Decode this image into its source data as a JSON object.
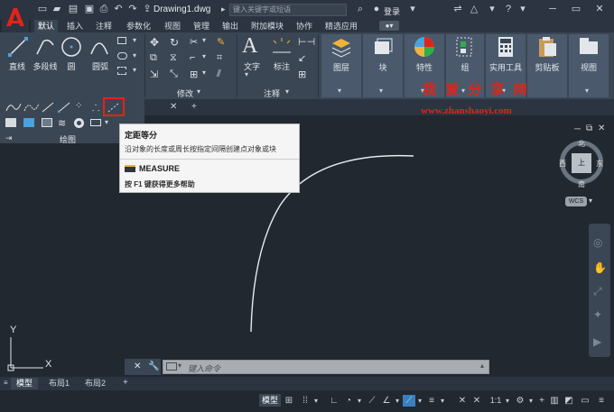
{
  "titlebar": {
    "document_title": "Drawing1.dwg",
    "search_placeholder": "键入关键字或短语",
    "login_label": "登录"
  },
  "menu_tabs": [
    "默认",
    "插入",
    "注释",
    "参数化",
    "视图",
    "管理",
    "输出",
    "附加模块",
    "协作",
    "精选应用"
  ],
  "ribbon": {
    "draw": {
      "tools": [
        "直线",
        "多段线",
        "圆",
        "圆弧"
      ],
      "panel_title": "绘图"
    },
    "modify": {
      "panel_title": "修改"
    },
    "annotation": {
      "tools": [
        "文字",
        "标注"
      ],
      "panel_title": "注释"
    },
    "big_tools": [
      "图层",
      "块",
      "特性",
      "组",
      "实用工具",
      "剪贴板",
      "视图"
    ]
  },
  "tooltip": {
    "title": "定距等分",
    "description": "沿对象的长度或周长按指定间隔创建点对象或块",
    "command": "MEASURE",
    "help": "按 F1 键获得更多帮助"
  },
  "watermark": {
    "title": "我 爱 分 享 网",
    "url": "www.zhanshaoyi.com"
  },
  "viewcube": {
    "north": "北",
    "south": "南",
    "east": "东",
    "west": "西",
    "top": "上",
    "wcs": "WCS"
  },
  "ucs": {
    "x": "X",
    "y": "Y"
  },
  "command_line": {
    "placeholder": "键入命令"
  },
  "layout_tabs": [
    "模型",
    "布局1",
    "布局2"
  ],
  "statusbar": {
    "model_label": "模型",
    "scale": "1:1"
  },
  "colors": {
    "highlight_red": "#e2231a",
    "ribbon_bg": "#3b4654",
    "canvas_bg": "#212830"
  }
}
